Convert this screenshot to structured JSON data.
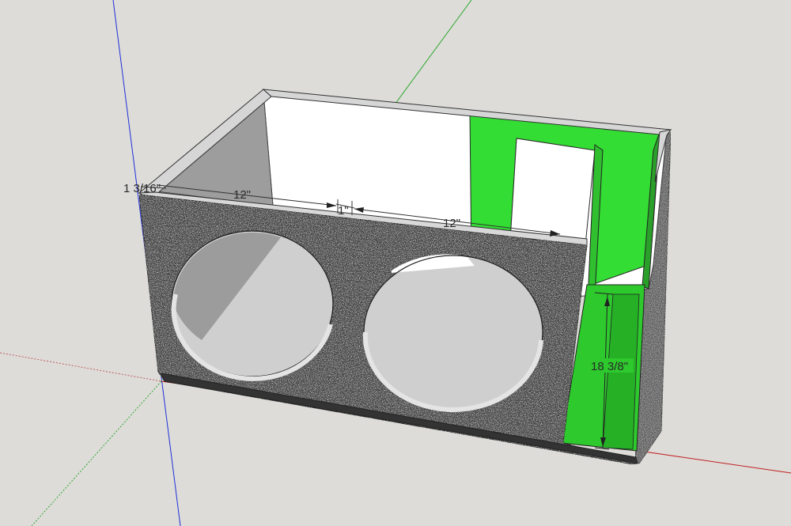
{
  "viewport": {
    "background": "#dddcd9"
  },
  "axes": {
    "blue_axis_color": "#1f2fd6",
    "green_axis_color": "#2ea82e",
    "red_axis_color": "#c02020"
  },
  "model": {
    "name": "speaker enclosure",
    "speaker_holes": 2,
    "carpet_color": "#5a5a5a",
    "port_color": "#33dd33",
    "interior_color": "#ffffff"
  },
  "dimensions": {
    "panel_thickness": "1 3/16\"",
    "left_chamber_width": "12\"",
    "divider_gap": "1\"",
    "right_chamber_width": "12\"",
    "port_height": "18 3/8\""
  }
}
